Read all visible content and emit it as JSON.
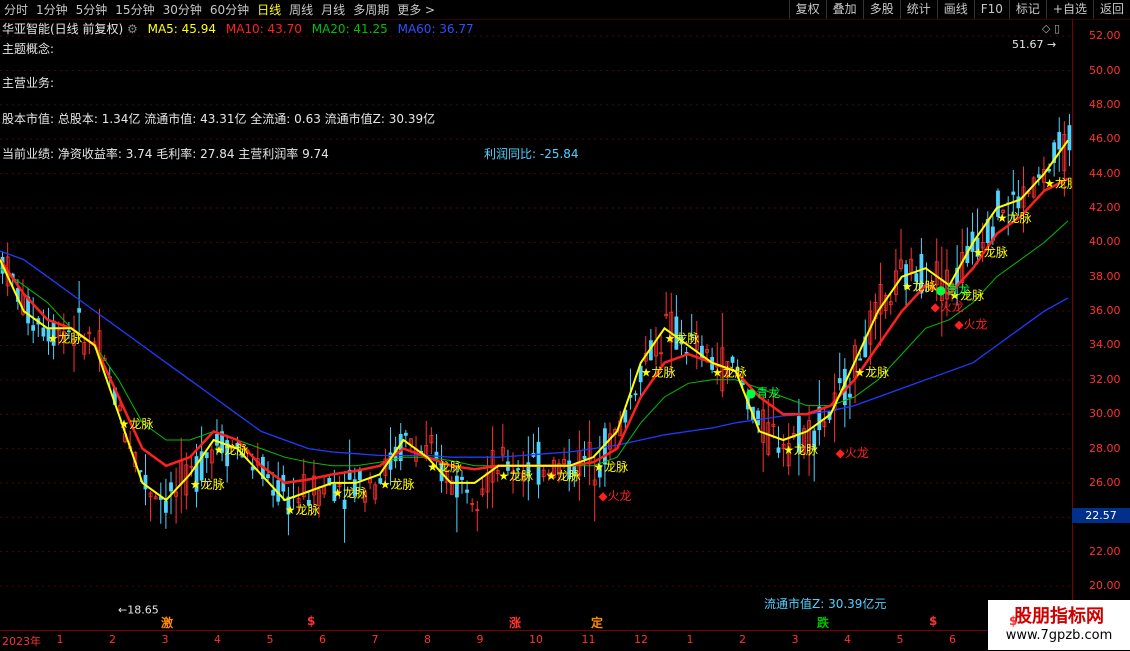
{
  "toolbar": {
    "tabs": [
      "分时",
      "1分钟",
      "5分钟",
      "15分钟",
      "30分钟",
      "60分钟",
      "日线",
      "周线",
      "月线",
      "多周期",
      "更多 >"
    ],
    "active_tab": "日线",
    "right_tools": [
      "复权",
      "叠加",
      "多股",
      "统计",
      "画线",
      "F10",
      "标记",
      "+自选",
      "返回"
    ]
  },
  "header": {
    "stock": "华亚智能(日线 前复权)",
    "ma5": "MA5: 45.94",
    "ma10": "MA10: 43.70",
    "ma20": "MA20: 41.25",
    "ma60": "MA60: 36.77"
  },
  "info": {
    "concept": "主题概念:",
    "business": "主营业务:",
    "capital": "股本市值: 总股本: 1.34亿 流通市值: 43.31亿 全流通: 0.63 流通市值Z: 30.39亿",
    "performance": "当前业绩: 净资收益率: 3.74 毛利率: 27.84 主营利润率 9.74",
    "profit_yoy": "利润同比: -25.84",
    "float_mv": "流通市值Z:  30.39亿元"
  },
  "colors": {
    "ma5": "#ffff00",
    "ma10": "#ff2020",
    "ma20": "#00c000",
    "ma60": "#1e3cff",
    "up": "#ff3232",
    "down": "#50d2ff",
    "signal": "#ffff00",
    "fire": "#ff2020",
    "cyan_signal": "#00ff40"
  },
  "chart_data": {
    "type": "line",
    "title": "",
    "ylim": [
      17.5,
      53
    ],
    "yticks": [
      20,
      22,
      24,
      26,
      28,
      30,
      32,
      34,
      36,
      38,
      40,
      42,
      44,
      46,
      48,
      50,
      52
    ],
    "x_labels": [
      "2023年",
      "1",
      "2",
      "3",
      "4",
      "5",
      "6",
      "7",
      "8",
      "9",
      "10",
      "11",
      "12",
      "1",
      "2",
      "3",
      "4",
      "5",
      "6",
      "7"
    ],
    "price_tag": "22.57",
    "annotations": {
      "high": "51.67",
      "low": "18.65"
    },
    "signals": {
      "dragon": "龙脉",
      "fire": "火龙",
      "green": "青龙"
    },
    "markers": [
      "激",
      "$",
      "涨",
      "定",
      "跌",
      "$",
      "$"
    ],
    "series": [
      {
        "name": "MA5",
        "values": [
          39.0,
          36.0,
          35.0,
          35.0,
          34.0,
          30.0,
          26.0,
          25.0,
          26.5,
          28.5,
          28.0,
          26.5,
          25.0,
          25.5,
          26.0,
          26.0,
          26.5,
          28.5,
          27.5,
          26.0,
          26.0,
          27.0,
          27.0,
          27.0,
          27.0,
          27.5,
          29.0,
          33.0,
          35.0,
          34.0,
          33.0,
          32.5,
          29.0,
          28.5,
          29.0,
          30.0,
          33.0,
          36.0,
          38.0,
          38.5,
          37.5,
          40.0,
          42.0,
          42.5,
          44.0,
          45.94
        ]
      },
      {
        "name": "MA10",
        "values": [
          39.0,
          37.0,
          35.5,
          35.0,
          34.0,
          31.0,
          28.0,
          27.0,
          27.5,
          29.0,
          28.5,
          27.0,
          26.0,
          26.2,
          26.5,
          26.7,
          27.0,
          28.0,
          27.5,
          27.0,
          26.8,
          27.0,
          27.0,
          27.0,
          27.0,
          27.2,
          28.0,
          31.0,
          33.0,
          33.5,
          33.0,
          32.5,
          31.0,
          30.0,
          30.0,
          30.5,
          32.0,
          34.0,
          36.0,
          37.5,
          37.0,
          38.5,
          40.5,
          41.5,
          43.0,
          43.7
        ]
      },
      {
        "name": "MA20",
        "values": [
          38.5,
          37.5,
          36.5,
          35.0,
          34.0,
          32.0,
          29.5,
          28.5,
          28.5,
          29.0,
          28.5,
          28.0,
          27.5,
          27.2,
          27.0,
          27.0,
          27.2,
          27.5,
          27.5,
          27.3,
          27.0,
          27.0,
          27.0,
          27.0,
          27.0,
          27.0,
          27.5,
          29.5,
          31.0,
          31.8,
          32.0,
          32.0,
          31.5,
          31.0,
          30.5,
          30.5,
          31.0,
          32.0,
          33.5,
          35.0,
          35.5,
          36.5,
          38.0,
          39.0,
          40.0,
          41.25
        ]
      },
      {
        "name": "MA60",
        "values": [
          39.5,
          39.0,
          38.0,
          37.0,
          36.0,
          35.0,
          34.0,
          33.0,
          32.0,
          31.0,
          30.0,
          29.0,
          28.5,
          28.0,
          27.8,
          27.7,
          27.6,
          27.6,
          27.6,
          27.5,
          27.5,
          27.5,
          27.6,
          27.7,
          27.8,
          28.0,
          28.2,
          28.5,
          28.8,
          29.0,
          29.2,
          29.5,
          29.7,
          29.9,
          30.0,
          30.2,
          30.5,
          31.0,
          31.5,
          32.0,
          32.5,
          33.0,
          34.0,
          35.0,
          36.0,
          36.77
        ]
      }
    ]
  }
}
